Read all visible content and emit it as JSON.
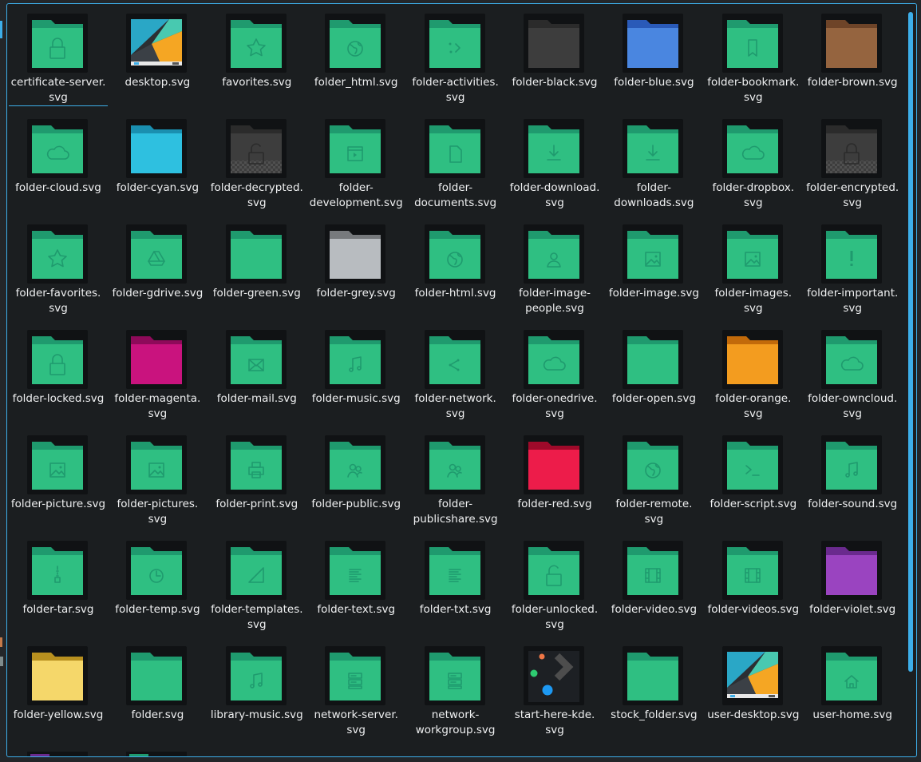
{
  "window": {
    "title": ""
  },
  "colors": {
    "accent": "#3daee9",
    "background": "#1b1e20",
    "text": "#eff0f1",
    "folder_default_back": "#1f9a6e",
    "folder_default_front": "#2fbf82"
  },
  "files": [
    {
      "label": "certificate-server.\nsvg",
      "icon": "lock-icon",
      "back": "#1f9a6e",
      "front": "#2fbf82",
      "type": "folder",
      "current": true
    },
    {
      "label": "desktop.svg",
      "icon": "desktop-icon",
      "type": "wallpaper"
    },
    {
      "label": "favorites.svg",
      "icon": "star-icon",
      "back": "#1f9a6e",
      "front": "#2fbf82",
      "type": "folder"
    },
    {
      "label": "folder_html.svg",
      "icon": "globe-icon",
      "back": "#1f9a6e",
      "front": "#2fbf82",
      "type": "folder"
    },
    {
      "label": "folder-activities.\nsvg",
      "icon": "activities-icon",
      "back": "#1f9a6e",
      "front": "#2fbf82",
      "type": "folder"
    },
    {
      "label": "folder-black.svg",
      "icon": "",
      "back": "#2b2b2b",
      "front": "#3d3d3d",
      "type": "folder"
    },
    {
      "label": "folder-blue.svg",
      "icon": "",
      "back": "#2a5ab8",
      "front": "#4a86e0",
      "type": "folder"
    },
    {
      "label": "folder-bookmark.\nsvg",
      "icon": "bookmark-icon",
      "back": "#1f9a6e",
      "front": "#2fbf82",
      "type": "folder"
    },
    {
      "label": "folder-brown.svg",
      "icon": "",
      "back": "#6e4428",
      "front": "#95643f",
      "type": "folder"
    },
    {
      "label": "folder-cloud.svg",
      "icon": "cloud-icon",
      "back": "#1f9a6e",
      "front": "#2fbf82",
      "type": "folder"
    },
    {
      "label": "folder-cyan.svg",
      "icon": "",
      "back": "#1a8fb0",
      "front": "#2ec0e0",
      "type": "folder"
    },
    {
      "label": "folder-decrypted.\nsvg",
      "icon": "unlock-icon",
      "back": "#2b2b2b",
      "front": "#3d3d3d",
      "type": "folder",
      "checker": true
    },
    {
      "label": "folder-\ndevelopment.svg",
      "icon": "code-window-icon",
      "back": "#1f9a6e",
      "front": "#2fbf82",
      "type": "folder"
    },
    {
      "label": "folder-\ndocuments.svg",
      "icon": "document-icon",
      "back": "#1f9a6e",
      "front": "#2fbf82",
      "type": "folder"
    },
    {
      "label": "folder-download.\nsvg",
      "icon": "download-icon",
      "back": "#1f9a6e",
      "front": "#2fbf82",
      "type": "folder"
    },
    {
      "label": "folder-\ndownloads.svg",
      "icon": "download-icon",
      "back": "#1f9a6e",
      "front": "#2fbf82",
      "type": "folder"
    },
    {
      "label": "folder-dropbox.\nsvg",
      "icon": "cloud-icon",
      "back": "#1f9a6e",
      "front": "#2fbf82",
      "type": "folder"
    },
    {
      "label": "folder-encrypted.\nsvg",
      "icon": "lock-icon",
      "back": "#2b2b2b",
      "front": "#3d3d3d",
      "type": "folder",
      "checker": true
    },
    {
      "label": "folder-favorites.\nsvg",
      "icon": "star-icon",
      "back": "#1f9a6e",
      "front": "#2fbf82",
      "type": "folder"
    },
    {
      "label": "folder-gdrive.svg",
      "icon": "gdrive-icon",
      "back": "#1f9a6e",
      "front": "#2fbf82",
      "type": "folder"
    },
    {
      "label": "folder-green.svg",
      "icon": "",
      "back": "#1f9a6e",
      "front": "#2fbf82",
      "type": "folder"
    },
    {
      "label": "folder-grey.svg",
      "icon": "",
      "back": "#777a7d",
      "front": "#b8bcc0",
      "type": "folder"
    },
    {
      "label": "folder-html.svg",
      "icon": "globe-icon",
      "back": "#1f9a6e",
      "front": "#2fbf82",
      "type": "folder"
    },
    {
      "label": "folder-image-\npeople.svg",
      "icon": "person-icon",
      "back": "#1f9a6e",
      "front": "#2fbf82",
      "type": "folder"
    },
    {
      "label": "folder-image.svg",
      "icon": "image-icon",
      "back": "#1f9a6e",
      "front": "#2fbf82",
      "type": "folder"
    },
    {
      "label": "folder-images.\nsvg",
      "icon": "image-icon",
      "back": "#1f9a6e",
      "front": "#2fbf82",
      "type": "folder"
    },
    {
      "label": "folder-important.\nsvg",
      "icon": "exclamation-icon",
      "back": "#1f9a6e",
      "front": "#2fbf82",
      "type": "folder"
    },
    {
      "label": "folder-locked.svg",
      "icon": "lock-icon",
      "back": "#1f9a6e",
      "front": "#2fbf82",
      "type": "folder"
    },
    {
      "label": "folder-magenta.\nsvg",
      "icon": "",
      "back": "#8e0a5a",
      "front": "#c9137e",
      "type": "folder"
    },
    {
      "label": "folder-mail.svg",
      "icon": "mail-icon",
      "back": "#1f9a6e",
      "front": "#2fbf82",
      "type": "folder"
    },
    {
      "label": "folder-music.svg",
      "icon": "music-icon",
      "back": "#1f9a6e",
      "front": "#2fbf82",
      "type": "folder"
    },
    {
      "label": "folder-network.\nsvg",
      "icon": "network-icon",
      "back": "#1f9a6e",
      "front": "#2fbf82",
      "type": "folder"
    },
    {
      "label": "folder-onedrive.\nsvg",
      "icon": "cloud-icon",
      "back": "#1f9a6e",
      "front": "#2fbf82",
      "type": "folder"
    },
    {
      "label": "folder-open.svg",
      "icon": "",
      "back": "#1f9a6e",
      "front": "#2fbf82",
      "type": "folder"
    },
    {
      "label": "folder-orange.\nsvg",
      "icon": "",
      "back": "#c26a0a",
      "front": "#f39c1f",
      "type": "folder"
    },
    {
      "label": "folder-owncloud.\nsvg",
      "icon": "cloud-icon",
      "back": "#1f9a6e",
      "front": "#2fbf82",
      "type": "folder"
    },
    {
      "label": "folder-picture.svg",
      "icon": "image-icon",
      "back": "#1f9a6e",
      "front": "#2fbf82",
      "type": "folder"
    },
    {
      "label": "folder-pictures.\nsvg",
      "icon": "image-icon",
      "back": "#1f9a6e",
      "front": "#2fbf82",
      "type": "folder"
    },
    {
      "label": "folder-print.svg",
      "icon": "printer-icon",
      "back": "#1f9a6e",
      "front": "#2fbf82",
      "type": "folder"
    },
    {
      "label": "folder-public.svg",
      "icon": "people-icon",
      "back": "#1f9a6e",
      "front": "#2fbf82",
      "type": "folder"
    },
    {
      "label": "folder-\npublicshare.svg",
      "icon": "people-icon",
      "back": "#1f9a6e",
      "front": "#2fbf82",
      "type": "folder"
    },
    {
      "label": "folder-red.svg",
      "icon": "",
      "back": "#9e0a2a",
      "front": "#ed1c4a",
      "type": "folder"
    },
    {
      "label": "folder-remote.\nsvg",
      "icon": "globe-icon",
      "back": "#1f9a6e",
      "front": "#2fbf82",
      "type": "folder"
    },
    {
      "label": "folder-script.svg",
      "icon": "terminal-icon",
      "back": "#1f9a6e",
      "front": "#2fbf82",
      "type": "folder"
    },
    {
      "label": "folder-sound.svg",
      "icon": "music-icon",
      "back": "#1f9a6e",
      "front": "#2fbf82",
      "type": "folder"
    },
    {
      "label": "folder-tar.svg",
      "icon": "zip-icon",
      "back": "#1f9a6e",
      "front": "#2fbf82",
      "type": "folder"
    },
    {
      "label": "folder-temp.svg",
      "icon": "clock-icon",
      "back": "#1f9a6e",
      "front": "#2fbf82",
      "type": "folder"
    },
    {
      "label": "folder-templates.\nsvg",
      "icon": "ruler-icon",
      "back": "#1f9a6e",
      "front": "#2fbf82",
      "type": "folder"
    },
    {
      "label": "folder-text.svg",
      "icon": "text-icon",
      "back": "#1f9a6e",
      "front": "#2fbf82",
      "type": "folder"
    },
    {
      "label": "folder-txt.svg",
      "icon": "text-icon",
      "back": "#1f9a6e",
      "front": "#2fbf82",
      "type": "folder"
    },
    {
      "label": "folder-unlocked.\nsvg",
      "icon": "unlock-icon",
      "back": "#1f9a6e",
      "front": "#2fbf82",
      "type": "folder"
    },
    {
      "label": "folder-video.svg",
      "icon": "film-icon",
      "back": "#1f9a6e",
      "front": "#2fbf82",
      "type": "folder"
    },
    {
      "label": "folder-videos.svg",
      "icon": "film-icon",
      "back": "#1f9a6e",
      "front": "#2fbf82",
      "type": "folder"
    },
    {
      "label": "folder-violet.svg",
      "icon": "",
      "back": "#6a2a8e",
      "front": "#9a44c0",
      "type": "folder"
    },
    {
      "label": "folder-yellow.svg",
      "icon": "",
      "back": "#b8901f",
      "front": "#f5d76a",
      "type": "folder"
    },
    {
      "label": "folder.svg",
      "icon": "",
      "back": "#1f9a6e",
      "front": "#2fbf82",
      "type": "folder"
    },
    {
      "label": "library-music.svg",
      "icon": "music-icon",
      "back": "#1f9a6e",
      "front": "#2fbf82",
      "type": "folder"
    },
    {
      "label": "network-server.\nsvg",
      "icon": "server-icon",
      "back": "#1f9a6e",
      "front": "#2fbf82",
      "type": "folder"
    },
    {
      "label": "network-\nworkgroup.svg",
      "icon": "server-icon",
      "back": "#1f9a6e",
      "front": "#2fbf82",
      "type": "folder"
    },
    {
      "label": "start-here-kde.\nsvg",
      "icon": "kde-logo-icon",
      "type": "kde"
    },
    {
      "label": "stock_folder.svg",
      "icon": "",
      "back": "#1f9a6e",
      "front": "#2fbf82",
      "type": "folder"
    },
    {
      "label": "user-desktop.svg",
      "icon": "desktop-icon",
      "type": "wallpaper"
    },
    {
      "label": "user-home.svg",
      "icon": "home-icon",
      "back": "#1f9a6e",
      "front": "#2fbf82",
      "type": "folder"
    }
  ],
  "partial_row_colors": [
    "#6a2a8e",
    "#1f9a6e"
  ]
}
